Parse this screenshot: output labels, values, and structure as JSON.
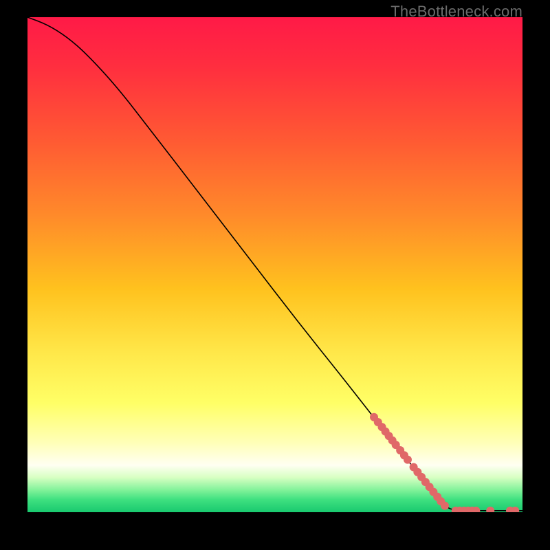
{
  "watermark": "TheBottleneck.com",
  "chart_data": {
    "type": "line",
    "title": "",
    "xlabel": "",
    "ylabel": "",
    "xlim": [
      0,
      100
    ],
    "ylim": [
      0,
      100
    ],
    "gradient_stops": [
      {
        "offset": 0,
        "color": "#ff1a47"
      },
      {
        "offset": 0.1,
        "color": "#ff2e3f"
      },
      {
        "offset": 0.25,
        "color": "#ff5a33"
      },
      {
        "offset": 0.4,
        "color": "#ff8a2a"
      },
      {
        "offset": 0.55,
        "color": "#ffc21e"
      },
      {
        "offset": 0.68,
        "color": "#ffe84a"
      },
      {
        "offset": 0.78,
        "color": "#ffff66"
      },
      {
        "offset": 0.86,
        "color": "#ffffb8"
      },
      {
        "offset": 0.905,
        "color": "#fffff2"
      },
      {
        "offset": 0.93,
        "color": "#d7ffc2"
      },
      {
        "offset": 0.955,
        "color": "#82f29a"
      },
      {
        "offset": 0.975,
        "color": "#3ee07f"
      },
      {
        "offset": 1.0,
        "color": "#19c96f"
      }
    ],
    "curve": [
      {
        "x": 0,
        "y": 100
      },
      {
        "x": 4,
        "y": 98.5
      },
      {
        "x": 8,
        "y": 96
      },
      {
        "x": 12,
        "y": 92.5
      },
      {
        "x": 18,
        "y": 86
      },
      {
        "x": 25,
        "y": 77
      },
      {
        "x": 35,
        "y": 64
      },
      {
        "x": 45,
        "y": 51
      },
      {
        "x": 55,
        "y": 38
      },
      {
        "x": 65,
        "y": 25.5
      },
      {
        "x": 72,
        "y": 16.5
      },
      {
        "x": 78,
        "y": 9
      },
      {
        "x": 82,
        "y": 4
      },
      {
        "x": 84.5,
        "y": 1.2
      },
      {
        "x": 86,
        "y": 0.3
      },
      {
        "x": 100,
        "y": 0.3
      }
    ],
    "points": [
      {
        "x": 70,
        "y": 19.2
      },
      {
        "x": 70.8,
        "y": 18.2
      },
      {
        "x": 71.6,
        "y": 17.2
      },
      {
        "x": 72.3,
        "y": 16.3
      },
      {
        "x": 73,
        "y": 15.4
      },
      {
        "x": 73.7,
        "y": 14.5
      },
      {
        "x": 74.4,
        "y": 13.6
      },
      {
        "x": 75.3,
        "y": 12.5
      },
      {
        "x": 76.1,
        "y": 11.5
      },
      {
        "x": 76.8,
        "y": 10.6
      },
      {
        "x": 78,
        "y": 9.1
      },
      {
        "x": 78.8,
        "y": 8.1
      },
      {
        "x": 79.6,
        "y": 7.1
      },
      {
        "x": 80.4,
        "y": 6.1
      },
      {
        "x": 81.2,
        "y": 5.1
      },
      {
        "x": 82,
        "y": 4.1
      },
      {
        "x": 82.8,
        "y": 3.1
      },
      {
        "x": 83.5,
        "y": 2.2
      },
      {
        "x": 84.3,
        "y": 1.3
      },
      {
        "x": 86.5,
        "y": 0.3
      },
      {
        "x": 87.3,
        "y": 0.3
      },
      {
        "x": 88.2,
        "y": 0.3
      },
      {
        "x": 89,
        "y": 0.3
      },
      {
        "x": 89.8,
        "y": 0.3
      },
      {
        "x": 90.6,
        "y": 0.3
      },
      {
        "x": 93.5,
        "y": 0.3
      },
      {
        "x": 97.5,
        "y": 0.3
      },
      {
        "x": 98.5,
        "y": 0.3
      }
    ],
    "point_color": "#e06868",
    "curve_color": "#000000",
    "curve_width": 1.6,
    "point_radius": 6
  }
}
